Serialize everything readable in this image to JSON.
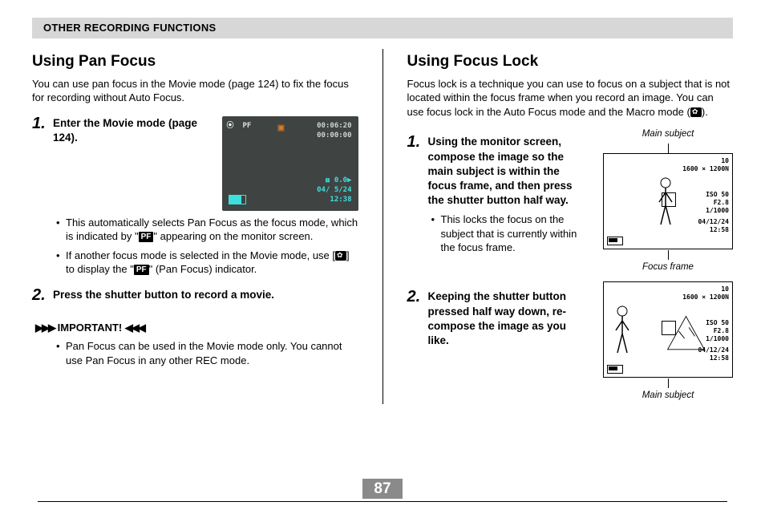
{
  "header": {
    "title": "OTHER RECORDING FUNCTIONS"
  },
  "page_number": "87",
  "left": {
    "heading": "Using Pan Focus",
    "intro": "You can use pan focus in the Movie mode (page 124) to fix the focus for recording without Auto Focus.",
    "step1": {
      "num": "1.",
      "text": "Enter the Movie mode (page 124).",
      "bullet1_a": "This automatically selects Pan Focus as the focus mode, which is indicated by \"",
      "bullet1_b": "\" appearing on the monitor screen.",
      "bullet2_a": "If another focus mode is selected in the Movie mode, use [",
      "bullet2_b": "] to display the \"",
      "bullet2_c": "\" (Pan Focus) indicator."
    },
    "step2": {
      "num": "2.",
      "text": "Press the shutter button to record a movie."
    },
    "important": {
      "label": "IMPORTANT!",
      "bullet": "Pan Focus can be used in the Movie mode only. You cannot use Pan Focus in any other REC mode."
    },
    "lcd": {
      "rec": "⦿",
      "pf": "PF",
      "t1": "00:06:20",
      "t2": "00:00:00",
      "ev": "⧈ 0.0▶",
      "date": "04/ 5/24",
      "time": "12:38"
    }
  },
  "right": {
    "heading": "Using Focus Lock",
    "intro_a": "Focus lock is a technique you can use to focus on a subject that is not located within the focus frame when you record an image. You can use focus lock in the Auto Focus mode and the Macro mode (",
    "intro_b": ").",
    "step1": {
      "num": "1.",
      "text": "Using the monitor screen, compose the image so the main subject is within the focus frame, and then press the shutter button half way.",
      "bullet": "This locks the focus on the subject that is currently within the focus frame.",
      "label_top": "Main subject",
      "label_bottom": "Focus frame"
    },
    "step2": {
      "num": "2.",
      "text": "Keeping the shutter button pressed half way down, re-compose the image as you like.",
      "label_bottom": "Main subject"
    },
    "diag": {
      "l1": "10",
      "l2": "1600 × 1200N",
      "l3": "ISO 50",
      "l4": "F2.8",
      "l5": "1/1000",
      "l6": "04/12/24",
      "l7": "12:58"
    }
  }
}
